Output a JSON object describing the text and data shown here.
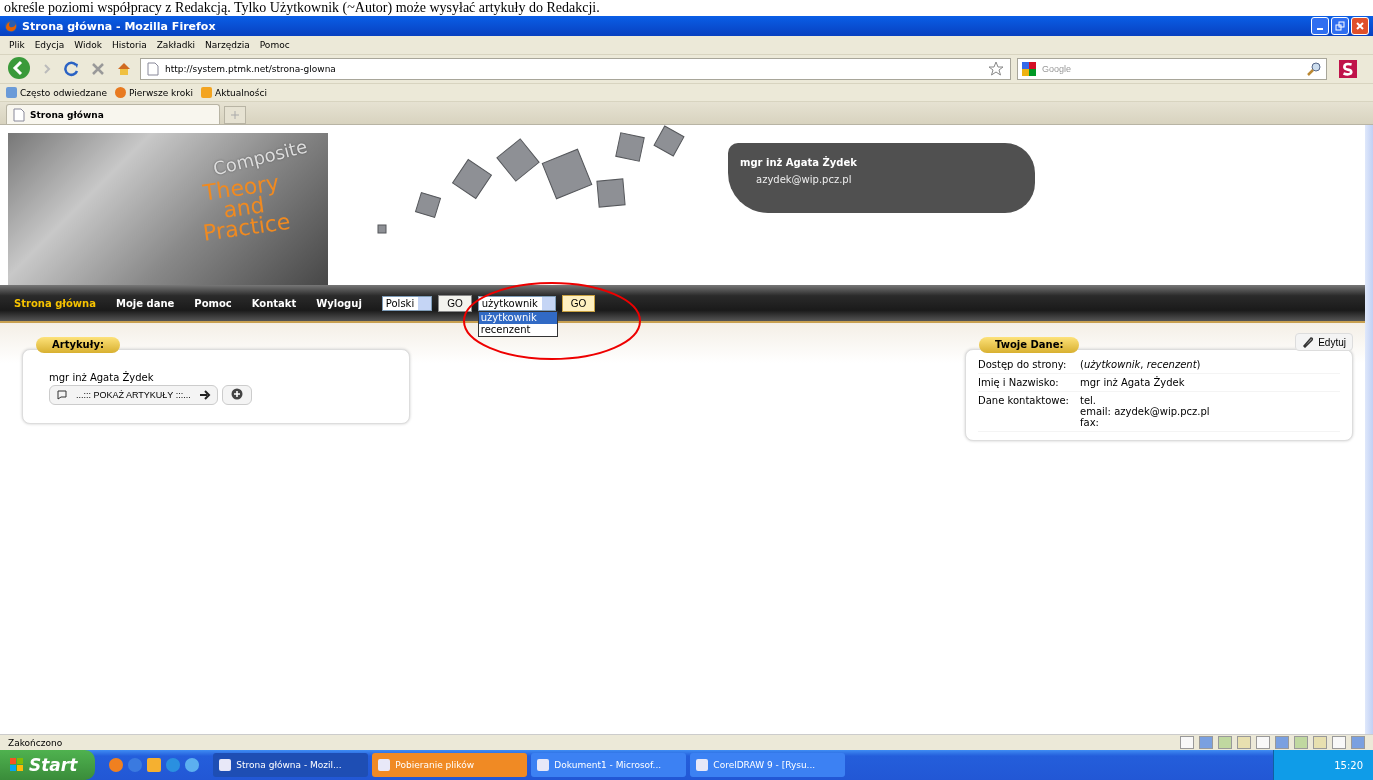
{
  "document_line": "określe poziomi współpracy z Redakcją. Tylko Użytkownik (~Autor) może wysyłać artykuły do Redakcji.",
  "window": {
    "title": "Strona główna - Mozilla Firefox"
  },
  "menu": [
    "Plik",
    "Edycja",
    "Widok",
    "Historia",
    "Zakładki",
    "Narzędzia",
    "Pomoc"
  ],
  "address": {
    "value": "http://system.ptmk.net/strona-glowna"
  },
  "search": {
    "placeholder": "Google"
  },
  "bookmarks": [
    "Często odwiedzane",
    "Pierwsze kroki",
    "Aktualności"
  ],
  "tabs": [
    {
      "label": "Strona główna",
      "selected": true
    }
  ],
  "logo": {
    "top": "Composite",
    "lines": [
      "Theory",
      "and",
      "Practice"
    ]
  },
  "user": {
    "name": "mgr inż Agata Żydek",
    "email": "azydek@wip.pcz.pl"
  },
  "nav": [
    {
      "label": "Strona główna",
      "selected": true
    },
    {
      "label": "Moje dane",
      "selected": false
    },
    {
      "label": "Pomoc",
      "selected": false
    },
    {
      "label": "Kontakt",
      "selected": false
    },
    {
      "label": "Wyloguj",
      "selected": false
    }
  ],
  "language_select": {
    "value": "Polski",
    "button": "GO"
  },
  "role_select": {
    "value": "użytkownik",
    "button": "GO",
    "expanded": true,
    "options": [
      {
        "label": "użytkownik",
        "selected": true
      },
      {
        "label": "recenzent",
        "selected": false
      }
    ]
  },
  "articles": {
    "title": "Artykuły:",
    "author": "mgr inż Agata Żydek",
    "show_button": "...::: POKAŻ ARTYKUŁY :::..."
  },
  "profile": {
    "title": "Twoje Dane:",
    "edit": "Edytuj",
    "rows": [
      {
        "label": "Dostęp do strony:",
        "lines": [
          "(*użytkownik*, *recenzent*)"
        ]
      },
      {
        "label": "Imię i Nazwisko:",
        "lines": [
          "mgr inż Agata Żydek"
        ]
      },
      {
        "label": "Dane kontaktowe:",
        "lines": [
          "tel.",
          "email: azydek@wip.pcz.pl",
          "fax:"
        ]
      }
    ]
  },
  "status_bar": "Zakończono",
  "taskbar": {
    "start": "Start",
    "items": [
      {
        "label": "Strona główna - Mozil...",
        "selected": true,
        "flashing": false
      },
      {
        "label": "Pobieranie plików",
        "selected": false,
        "flashing": true
      },
      {
        "label": "Dokument1 - Microsof...",
        "selected": false,
        "flashing": false
      },
      {
        "label": "CorelDRAW 9 - [Rysu...",
        "selected": false,
        "flashing": false
      }
    ],
    "clock": "15:20"
  }
}
